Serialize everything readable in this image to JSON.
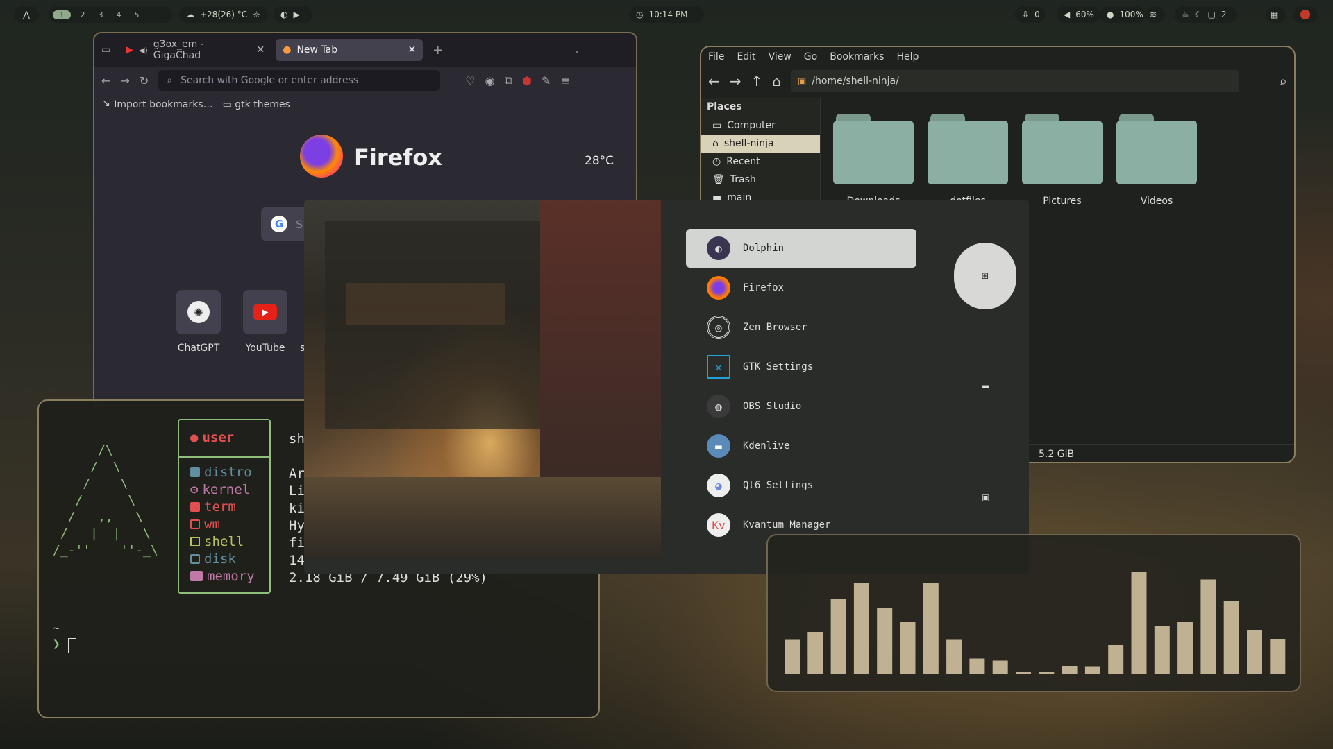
{
  "topbar": {
    "workspaces": [
      "1",
      "2",
      "3",
      "4",
      "5"
    ],
    "weather": "+28(26) °C",
    "clock": "10:14 PM",
    "downloads": "0",
    "volume": "60%",
    "mic": "100%",
    "notifications": "2"
  },
  "firefox": {
    "tabs": [
      {
        "label": "g3ox_em - GigaChad"
      },
      {
        "label": "New Tab"
      }
    ],
    "url_placeholder": "Search with Google or enter address",
    "bookmarks": [
      "Import bookmarks…",
      "gtk themes"
    ],
    "brand": "Firefox",
    "weather": "28°C",
    "shortcuts": [
      "ChatGPT",
      "YouTube"
    ],
    "partial_shortcut": "s",
    "search_partial": "S"
  },
  "filemanager": {
    "menu": [
      "File",
      "Edit",
      "View",
      "Go",
      "Bookmarks",
      "Help"
    ],
    "path": "/home/shell-ninja/",
    "places_title": "Places",
    "places": [
      "Computer",
      "shell-ninja",
      "Recent",
      "Trash",
      "main"
    ],
    "folders": [
      "Downloads",
      "dotfiles",
      "Pictures",
      "Videos"
    ],
    "status": "5.2 GiB"
  },
  "terminal": {
    "user": "user",
    "labels": [
      "distro",
      "kernel",
      "term",
      "wm",
      "shell",
      "disk",
      "memory"
    ],
    "values": [
      "sh",
      "Ar",
      "Li",
      "ki",
      "Hy",
      "fi",
      "14",
      "2.18 GiB / 7.49 GiB (29%)"
    ],
    "prompt_dir": "~",
    "prompt": "❯"
  },
  "launcher": {
    "apps": [
      "Dolphin",
      "Firefox",
      "Zen Browser",
      "GTK Settings",
      "OBS Studio",
      "Kdenlive",
      "Qt6 Settings",
      "Kvantum Manager"
    ]
  },
  "visualizer": {
    "levels": [
      0.33,
      0.4,
      0.72,
      0.88,
      0.64,
      0.5,
      0.88,
      0.33,
      0.15,
      0.13,
      0.02,
      0.02,
      0.08,
      0.07,
      0.28,
      0.98,
      0.46,
      0.5,
      0.91,
      0.7,
      0.42,
      0.34
    ]
  },
  "colors": {
    "accent": "#8fbf7a",
    "bar": "#bfb191"
  }
}
